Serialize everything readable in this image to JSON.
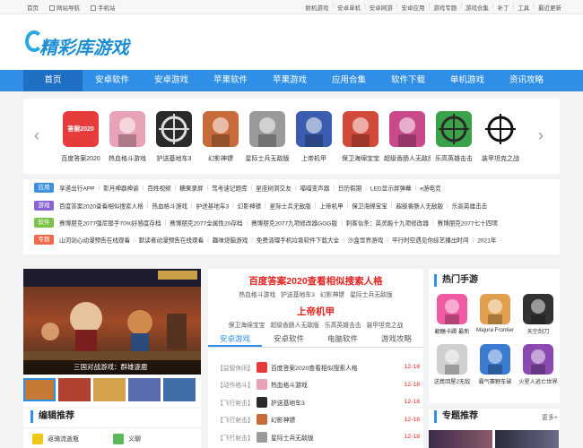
{
  "topbar": {
    "left": [
      "首页",
      "网站导航",
      "手机站"
    ],
    "right": [
      "射机游戏",
      "安卓单机",
      "安卓网游",
      "安卓应用",
      "游戏专题",
      "游戏合集",
      "补丁",
      "工具",
      "最近更新"
    ]
  },
  "logo": {
    "text": "精彩库游戏"
  },
  "nav": [
    "首页",
    "安卓软件",
    "安卓游戏",
    "苹果软件",
    "苹果游戏",
    "应用合集",
    "软件下载",
    "单机游戏",
    "资讯攻略"
  ],
  "slider": {
    "items": [
      {
        "name": "百度答案2020",
        "icon": "baidu-answer-icon",
        "color": "#e83b3b",
        "label": "答案2020"
      },
      {
        "name": "热血格斗游戏",
        "icon": "fighter-girl-icon",
        "color": "#e9a3b7"
      },
      {
        "name": "护送基地车3",
        "icon": "sniper-scope-icon",
        "color": "#2a2a2a"
      },
      {
        "name": "幻影神镖",
        "icon": "phantom-dart-icon",
        "color": "#c76b3b"
      },
      {
        "name": "星际士兵无敌版",
        "icon": "soldier-icon",
        "color": "#9a9a9a"
      },
      {
        "name": "上帝机甲",
        "icon": "mecha-icon",
        "color": "#3b5db0"
      },
      {
        "name": "保卫海绵宝宝",
        "icon": "sponge-defense-icon",
        "color": "#d24a3a"
      },
      {
        "name": "超级香肠人无敌版",
        "icon": "sausage-man-icon",
        "color": "#c94a8a"
      },
      {
        "name": "乐高英雄击击",
        "icon": "crosshair-green-icon",
        "color": "#3aa34a"
      },
      {
        "name": "装甲坦克之战",
        "icon": "crosshair-black-icon",
        "color": "#ffffff"
      }
    ]
  },
  "tagrows": [
    {
      "badge": "应用",
      "color": "#3d8fe0",
      "links": [
        "享道出行APP",
        "影月神器神谕",
        "百姓视频",
        "糖果录屏",
        "驾考速记题库",
        "星座树洞交友",
        "喵喵变声器",
        "日历假期",
        "LED显示屏弹幕",
        "e游电竞"
      ]
    },
    {
      "badge": "游戏",
      "color": "#8a63d2",
      "links": [
        "百度答案2020查看相似搜索人格",
        "热血格斗游戏",
        "护送基地车3",
        "幻影神镖",
        "星际士兵无敌版",
        "上帝机甲",
        "保卫海绵宝宝",
        "超级香肠人无敌版",
        "乐高英雄击击"
      ]
    },
    {
      "badge": "软件",
      "color": "#7cc24a",
      "links": [
        "赛博朋克2077强尼银手70%好感度存档",
        "赛博朋克2077全属性20存档",
        "赛博朋克2077九项修改器GOG版",
        "刺客信条：英灵殿十九项修改器",
        "赛博朋克2077七十四项"
      ]
    },
    {
      "badge": "专题",
      "color": "#f06a4a",
      "links": [
        "山河剑心动漫预告在线观看",
        "默读者动漫预告在线观看",
        "趣味烧脑游戏",
        "免费清理手机垃圾软件下载大全",
        "沙盒世界游戏",
        "平行时空遇见你综艺播出时间",
        "2021年"
      ]
    }
  ],
  "feature": {
    "caption": "三国对战游戏：群雄逐鹿",
    "thumbs": 5
  },
  "editor": {
    "title": "编辑推荐",
    "items": [
      {
        "name": "返骑流逝瓶",
        "icon": "bottle-icon",
        "color": "#f0c419"
      },
      {
        "name": "义聊",
        "icon": "chat-icon",
        "color": "#5bb85a"
      }
    ]
  },
  "middle": {
    "headline1": "百度答案2020查看相似搜索人格",
    "sub1": [
      "热血格斗游戏",
      "护送基地车3",
      "幻影神镖",
      "星际士兵无敌版"
    ],
    "headline2": "上帝机甲",
    "sub2": [
      "保卫海绵宝宝",
      "超级香肠人无敌版",
      "乐高英雄击击",
      "装甲坦克之战"
    ],
    "tabs": [
      "安卓游戏",
      "安卓软件",
      "电脑软件",
      "游戏攻略"
    ],
    "list": [
      {
        "cat": "【益智休闲】",
        "name": "百度答案2020查看相似搜索人格",
        "date": "12-18",
        "color": "#e83b3b"
      },
      {
        "cat": "【动作格斗】",
        "name": "热血格斗游戏",
        "date": "12-18",
        "color": "#e9a3b7"
      },
      {
        "cat": "【飞行射击】",
        "name": "护送基地车3",
        "date": "12-18",
        "color": "#2a2a2a"
      },
      {
        "cat": "【飞行射击】",
        "name": "幻影神镖",
        "date": "12-18",
        "color": "#c76b3b"
      },
      {
        "cat": "【飞行射击】",
        "name": "星际士兵无敌版",
        "date": "12-18",
        "color": "#9a9a9a"
      }
    ]
  },
  "hot": {
    "title": "热门手游",
    "items": [
      {
        "name": "翻糖卡踢 最新",
        "icon": "pink-char-icon",
        "color": "#f05aa0"
      },
      {
        "name": "Majura Frontier",
        "icon": "anime-girl-icon",
        "color": "#e0a050"
      },
      {
        "name": "天空刮刀",
        "icon": "dark-warrior-icon",
        "color": "#333333"
      },
      {
        "name": "送葬回屋2无敌",
        "icon": "shooter-icon",
        "color": "#cfcfcf"
      },
      {
        "name": "霸气赛野车破",
        "icon": "race-car-icon",
        "color": "#3b7bd0"
      },
      {
        "name": "火星人逃亡世界",
        "icon": "martian-icon",
        "color": "#8a4ab0"
      }
    ]
  },
  "topic": {
    "title": "专题推荐",
    "more": "更多+"
  }
}
